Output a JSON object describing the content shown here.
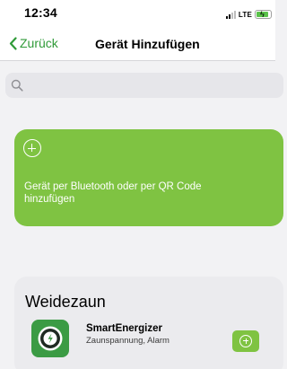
{
  "status_bar": {
    "time": "12:34",
    "network": "LTE",
    "icons": [
      "signal-icon",
      "battery-charging-icon"
    ]
  },
  "nav": {
    "back_label": "Zurück",
    "title": "Gerät Hinzufügen",
    "back_icon": "chevron-left-icon"
  },
  "search": {
    "placeholder": "",
    "value": "",
    "icon": "search-icon"
  },
  "add_card": {
    "icon": "plus-circle-icon",
    "text": "Gerät per Bluetooth oder per QR Code hinzufügen"
  },
  "categories": [
    {
      "title": "Weidezaun",
      "devices": [
        {
          "name": "SmartEnergizer",
          "description": "Zaunspannung, Alarm",
          "icon": "energizer-lightning-icon",
          "add_icon": "plus-circle-icon"
        }
      ]
    }
  ],
  "colors": {
    "accent_green": "#7fc342",
    "link_green": "#2f9a38",
    "device_icon_green": "#3b9b44"
  }
}
